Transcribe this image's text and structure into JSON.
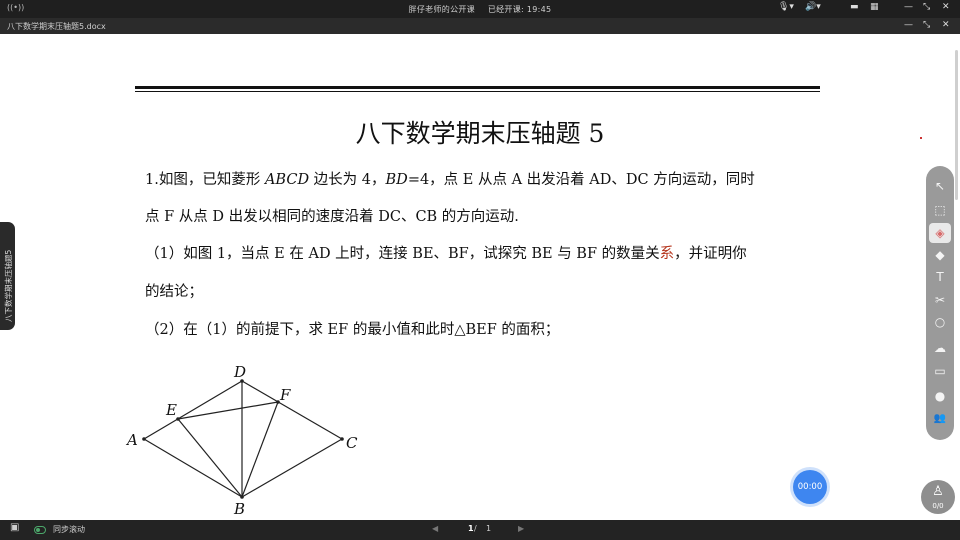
{
  "app": {
    "live_icon": "((•))",
    "title": "胖仔老师的公开课",
    "status": "已经开课: 19:45",
    "window_controls": [
      "—",
      "⤡",
      "✕"
    ],
    "top_controls": [
      "🎙▾",
      "🔊▾",
      "▬",
      "▦"
    ]
  },
  "document": {
    "file_name": "八下数学期末压轴题5.docx",
    "doc_window_controls": [
      "—",
      "⤡",
      "✕"
    ],
    "title": "八下数学期末压轴题 5",
    "problem": {
      "line1_prefix": "1.如图，已知菱形 ",
      "line1_abcd": "ABCD",
      "line1_mid": " 边长为 4，",
      "line1_bd": "BD",
      "line1_rest": "=4，点 E 从点 A 出发沿着 AD、DC 方向运动，同时",
      "line2": "点 F 从点 D 出发以相同的速度沿着 DC、CB 的方向运动.",
      "q1_line1_before": "（1）如图 1，当点 E 在 AD 上时，连接 BE、BF，试探究 BE 与 BF 的数量关",
      "q1_line1_hl": "系",
      "q1_line1_after": "，并证明你",
      "q1_line2": "的结论；",
      "q2": "（2）在（1）的前提下，求 EF 的最小值和此时△BEF 的面积；"
    },
    "figure_labels": {
      "A": "A",
      "B": "B",
      "C": "C",
      "D": "D",
      "E": "E",
      "F": "F"
    }
  },
  "side_tab": {
    "label": "八下数学期末压轴题5"
  },
  "toolbar": {
    "tools": [
      {
        "icon": "pointer-icon",
        "glyph": "↖"
      },
      {
        "icon": "select-area-icon",
        "glyph": "⬚"
      },
      {
        "icon": "eraser-icon",
        "glyph": "◈"
      },
      {
        "icon": "highlighter-icon",
        "glyph": "◆"
      },
      {
        "icon": "text-icon",
        "glyph": "T"
      },
      {
        "icon": "scissors-icon",
        "glyph": "✂"
      },
      {
        "icon": "shape-icon",
        "glyph": "○"
      },
      {
        "icon": "cloud-icon",
        "glyph": "☁"
      },
      {
        "icon": "toolbox-icon",
        "glyph": "▭"
      },
      {
        "icon": "chat-icon",
        "glyph": "●"
      },
      {
        "icon": "users-icon",
        "glyph": "👥"
      }
    ]
  },
  "timer": {
    "value": "00:00"
  },
  "seat": {
    "glyph": "♙",
    "count": "0/0"
  },
  "bottom": {
    "view_icon": "▣",
    "sync_label": "同步滚动",
    "page_current": "1",
    "page_sep": " / ",
    "page_total": "1",
    "prev_glyph": "◀",
    "next_glyph": "▶"
  }
}
